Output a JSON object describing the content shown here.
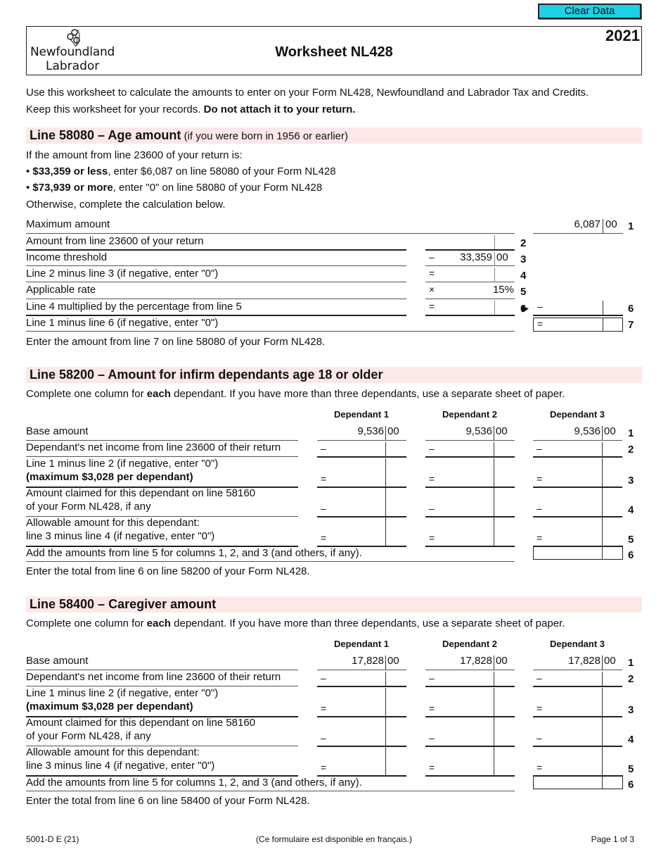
{
  "toolbar": {
    "clear_data_label": "Clear Data"
  },
  "header": {
    "logo_line1": "Newfoundland",
    "logo_line2": "Labrador",
    "title": "Worksheet NL428",
    "year": "2021"
  },
  "intro": {
    "line1": "Use this worksheet to calculate the amounts to enter on your Form NL428, Newfoundland and Labrador Tax and Credits.",
    "line2_normal": "Keep this worksheet for your records. ",
    "line2_bold": "Do not attach it to your return."
  },
  "age_amount": {
    "title": "Line 58080 – Age amount",
    "title_sub": " (if you were born in 1956 or earlier)",
    "intro": "If the amount from line 23600 of your return is:",
    "bullet1_bold": "$33,359 or less",
    "bullet1_rest": ", enter $6,087 on line 58080 of your Form NL428",
    "bullet2_bold": "$73,939 or more",
    "bullet2_rest": ", enter \"0\" on line 58080 of your Form NL428",
    "otherwise": "Otherwise, complete the calculation below.",
    "rows": [
      {
        "label": "Maximum amount",
        "num": "1",
        "amount": "6,087",
        "cents": "00"
      },
      {
        "label": "Amount from line 23600 of your return",
        "num": "2",
        "amount": "",
        "cents": ""
      },
      {
        "label": "Income threshold",
        "num": "3",
        "symbol": "–",
        "amount": "33,359",
        "cents": "00"
      },
      {
        "label": "Line 2 minus line 3 (if negative, enter \"0\")",
        "num": "4",
        "symbol": "=",
        "amount": "",
        "cents": ""
      },
      {
        "label": "Applicable rate",
        "num": "5",
        "symbol": "×",
        "amount": "15%"
      },
      {
        "label": "Line 4 multiplied by the percentage from line 5",
        "num": "6",
        "symbol": "=",
        "symbol_right": "–",
        "amount": "",
        "cents": ""
      },
      {
        "label": "Line 1 minus line 6 (if negative, enter \"0\")",
        "num": "7",
        "symbol": "=",
        "amount": "",
        "cents": ""
      }
    ],
    "footer": "Enter the amount from line 7 on line 58080 of your Form NL428."
  },
  "infirm": {
    "title": "Line 58200 – Amount for infirm dependants age 18 or older",
    "instr_a": "Complete one column for ",
    "instr_b": "each",
    "instr_c": " dependant. If you have more than three dependants, use a separate sheet of paper.",
    "columns": [
      "Dependant 1",
      "Dependant 2",
      "Dependant 3"
    ],
    "rows": [
      {
        "label1": "Base amount",
        "num": "1",
        "values": [
          "9,536",
          "9,536",
          "9,536"
        ],
        "cents": "00"
      },
      {
        "label1": "Dependant's net income from line 23600 of their return",
        "num": "2",
        "symbol": "–"
      },
      {
        "label1": "Line 1 minus line 2 (if negative, enter \"0\")",
        "label2": "(maximum $3,028 per dependant)",
        "num": "3",
        "symbol": "="
      },
      {
        "label1": "Amount claimed for this dependant on line 58160",
        "label2": "of your Form NL428, if any",
        "num": "4",
        "symbol": "–"
      },
      {
        "label1": "Allowable amount for this dependant:",
        "label2": "line 3 minus line 4 (if negative, enter \"0\")",
        "num": "5",
        "symbol": "="
      },
      {
        "label1": "Add the amounts from line 5 for columns 1, 2, and 3 (and others, if any).",
        "num": "6"
      }
    ],
    "footer": "Enter the total from line 6 on line 58200 of your Form NL428."
  },
  "caregiver": {
    "title": "Line 58400 – Caregiver amount",
    "instr_a": "Complete one column for ",
    "instr_b": "each",
    "instr_c": " dependant. If you have more than three dependants, use a separate sheet of paper.",
    "columns": [
      "Dependant 1",
      "Dependant 2",
      "Dependant 3"
    ],
    "rows": [
      {
        "label1": "Base amount",
        "num": "1",
        "values": [
          "17,828",
          "17,828",
          "17,828"
        ],
        "cents": "00"
      },
      {
        "label1": "Dependant's net income from line 23600 of their return",
        "num": "2",
        "symbol": "–"
      },
      {
        "label1": "Line 1 minus line 2 (if negative, enter \"0\")",
        "label2": "(maximum $3,028 per dependant)",
        "num": "3",
        "symbol": "="
      },
      {
        "label1": "Amount claimed for this dependant on line 58160",
        "label2": "of your Form NL428, if any",
        "num": "4",
        "symbol": "–"
      },
      {
        "label1": "Allowable amount for this dependant:",
        "label2": "line 3 minus line 4 (if negative, enter \"0\")",
        "num": "5",
        "symbol": "="
      },
      {
        "label1": "Add the amounts from line 5 for columns 1, 2, and 3 (and others, if any).",
        "num": "6"
      }
    ],
    "footer": "Enter the total from line 6 on line 58400 of your Form NL428."
  },
  "footer": {
    "form_code": "5001-D E (21)",
    "french_note": "(Ce formulaire est disponible en français.)",
    "page": "Page 1 of 3"
  },
  "icons": {
    "arrow": "▶"
  }
}
